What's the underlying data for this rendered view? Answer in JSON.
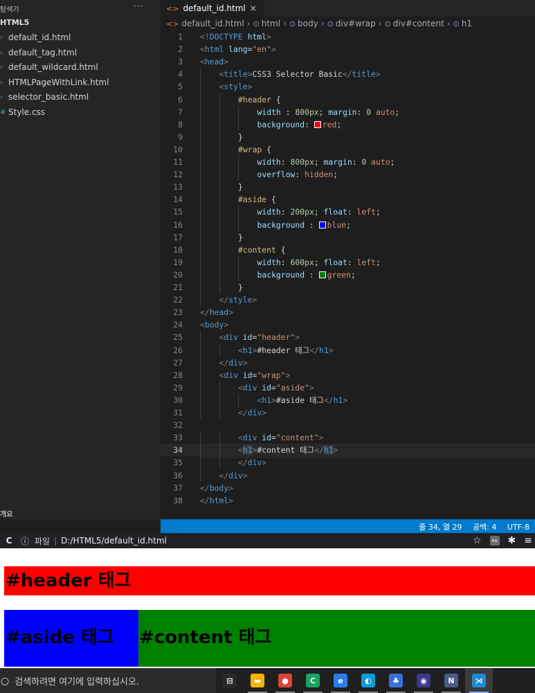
{
  "sidebar": {
    "header": "탐색기",
    "more": "···",
    "folder": "HTML5",
    "files": [
      {
        "name": "default_id.html",
        "icon": "html-file-icon"
      },
      {
        "name": "default_tag.html",
        "icon": "html-file-icon"
      },
      {
        "name": "default_wildcard.html",
        "icon": "html-file-icon"
      },
      {
        "name": "HTMLPageWithLink.html",
        "icon": "html-file-icon"
      },
      {
        "name": "selector_basic.html",
        "icon": "html-file-icon"
      },
      {
        "name": "Style.css",
        "icon": "css-file-icon"
      }
    ],
    "outline": "개요"
  },
  "tab": {
    "label": "default_id.html",
    "close": "×"
  },
  "breadcrumb": [
    "default_id.html",
    "html",
    "body",
    "div#wrap",
    "div#content",
    "h1"
  ],
  "editor": {
    "active_line": 34,
    "lines": [
      {
        "n": 1,
        "indent": 0,
        "tokens": [
          [
            "br",
            "<!"
          ],
          [
            "tg",
            "DOCTYPE"
          ],
          [
            "tx",
            " "
          ],
          [
            "at",
            "html"
          ],
          [
            "br",
            ">"
          ]
        ]
      },
      {
        "n": 2,
        "indent": 0,
        "tokens": [
          [
            "br",
            "<"
          ],
          [
            "tg",
            "html"
          ],
          [
            "tx",
            " "
          ],
          [
            "at",
            "lang"
          ],
          [
            "tx",
            "="
          ],
          [
            "sv",
            "\"en\""
          ],
          [
            "br",
            ">"
          ]
        ]
      },
      {
        "n": 3,
        "indent": 0,
        "tokens": [
          [
            "br",
            "<"
          ],
          [
            "tg",
            "head"
          ],
          [
            "br",
            ">"
          ]
        ]
      },
      {
        "n": 4,
        "indent": 1,
        "tokens": [
          [
            "br",
            "<"
          ],
          [
            "tg",
            "title"
          ],
          [
            "br",
            ">"
          ],
          [
            "tx",
            "CSS3 Selector Basic"
          ],
          [
            "br",
            "</"
          ],
          [
            "tg",
            "title"
          ],
          [
            "br",
            ">"
          ]
        ]
      },
      {
        "n": 5,
        "indent": 1,
        "tokens": [
          [
            "br",
            "<"
          ],
          [
            "tg",
            "style"
          ],
          [
            "br",
            ">"
          ]
        ]
      },
      {
        "n": 6,
        "indent": 2,
        "tokens": [
          [
            "sel",
            "#header"
          ],
          [
            "tx",
            " {"
          ]
        ]
      },
      {
        "n": 7,
        "indent": 3,
        "tokens": [
          [
            "pr",
            "width"
          ],
          [
            "tx",
            " : "
          ],
          [
            "nm",
            "800px"
          ],
          [
            "tx",
            "; "
          ],
          [
            "pr",
            "margin"
          ],
          [
            "tx",
            ": "
          ],
          [
            "nm",
            "0"
          ],
          [
            "tx",
            " "
          ],
          [
            "vl",
            "auto"
          ],
          [
            "tx",
            ";"
          ]
        ]
      },
      {
        "n": 8,
        "indent": 3,
        "tokens": [
          [
            "pr",
            "background"
          ],
          [
            "tx",
            ": "
          ],
          [
            "sw",
            "#ff0000"
          ],
          [
            "vl",
            "red"
          ],
          [
            "tx",
            ";"
          ]
        ]
      },
      {
        "n": 9,
        "indent": 2,
        "tokens": [
          [
            "tx",
            "}"
          ]
        ]
      },
      {
        "n": 10,
        "indent": 2,
        "tokens": [
          [
            "sel",
            "#wrap"
          ],
          [
            "tx",
            " {"
          ]
        ]
      },
      {
        "n": 11,
        "indent": 3,
        "tokens": [
          [
            "pr",
            "width"
          ],
          [
            "tx",
            ": "
          ],
          [
            "nm",
            "800px"
          ],
          [
            "tx",
            "; "
          ],
          [
            "pr",
            "margin"
          ],
          [
            "tx",
            ": "
          ],
          [
            "nm",
            "0"
          ],
          [
            "tx",
            " "
          ],
          [
            "vl",
            "auto"
          ],
          [
            "tx",
            ";"
          ]
        ]
      },
      {
        "n": 12,
        "indent": 3,
        "tokens": [
          [
            "pr",
            "overflow"
          ],
          [
            "tx",
            ": "
          ],
          [
            "vl",
            "hidden"
          ],
          [
            "tx",
            ";"
          ]
        ]
      },
      {
        "n": 13,
        "indent": 2,
        "tokens": [
          [
            "tx",
            "}"
          ]
        ]
      },
      {
        "n": 14,
        "indent": 2,
        "tokens": [
          [
            "sel",
            "#aside"
          ],
          [
            "tx",
            " {"
          ]
        ]
      },
      {
        "n": 15,
        "indent": 3,
        "tokens": [
          [
            "pr",
            "width"
          ],
          [
            "tx",
            ": "
          ],
          [
            "nm",
            "200px"
          ],
          [
            "tx",
            "; "
          ],
          [
            "pr",
            "float"
          ],
          [
            "tx",
            ": "
          ],
          [
            "vl",
            "left"
          ],
          [
            "tx",
            ";"
          ]
        ]
      },
      {
        "n": 16,
        "indent": 3,
        "tokens": [
          [
            "pr",
            "background"
          ],
          [
            "tx",
            " : "
          ],
          [
            "sw",
            "#0000ff"
          ],
          [
            "vl",
            "blue"
          ],
          [
            "tx",
            ";"
          ]
        ]
      },
      {
        "n": 17,
        "indent": 2,
        "tokens": [
          [
            "tx",
            "}"
          ]
        ]
      },
      {
        "n": 18,
        "indent": 2,
        "tokens": [
          [
            "sel",
            "#content"
          ],
          [
            "tx",
            " {"
          ]
        ]
      },
      {
        "n": 19,
        "indent": 3,
        "tokens": [
          [
            "pr",
            "width"
          ],
          [
            "tx",
            ": "
          ],
          [
            "nm",
            "600px"
          ],
          [
            "tx",
            "; "
          ],
          [
            "pr",
            "float"
          ],
          [
            "tx",
            ": "
          ],
          [
            "vl",
            "left"
          ],
          [
            "tx",
            ";"
          ]
        ]
      },
      {
        "n": 20,
        "indent": 3,
        "tokens": [
          [
            "pr",
            "background"
          ],
          [
            "tx",
            " : "
          ],
          [
            "sw",
            "#008000"
          ],
          [
            "vl",
            "green"
          ],
          [
            "tx",
            ";"
          ]
        ]
      },
      {
        "n": 21,
        "indent": 2,
        "tokens": [
          [
            "tx",
            "}"
          ]
        ]
      },
      {
        "n": 22,
        "indent": 1,
        "tokens": [
          [
            "br",
            "</"
          ],
          [
            "tg",
            "style"
          ],
          [
            "br",
            ">"
          ]
        ]
      },
      {
        "n": 23,
        "indent": 0,
        "tokens": [
          [
            "br",
            "</"
          ],
          [
            "tg",
            "head"
          ],
          [
            "br",
            ">"
          ]
        ]
      },
      {
        "n": 24,
        "indent": 0,
        "tokens": [
          [
            "br",
            "<"
          ],
          [
            "tg",
            "body"
          ],
          [
            "br",
            ">"
          ]
        ]
      },
      {
        "n": 25,
        "indent": 1,
        "tokens": [
          [
            "br",
            "<"
          ],
          [
            "tg",
            "div"
          ],
          [
            "tx",
            " "
          ],
          [
            "at",
            "id"
          ],
          [
            "tx",
            "="
          ],
          [
            "sv",
            "\"header\""
          ],
          [
            "br",
            ">"
          ]
        ]
      },
      {
        "n": 26,
        "indent": 2,
        "tokens": [
          [
            "br",
            "<"
          ],
          [
            "tg",
            "h1"
          ],
          [
            "br",
            ">"
          ],
          [
            "tx",
            "#header 태그"
          ],
          [
            "br",
            "</"
          ],
          [
            "tg",
            "h1"
          ],
          [
            "br",
            ">"
          ]
        ]
      },
      {
        "n": 27,
        "indent": 1,
        "tokens": [
          [
            "br",
            "</"
          ],
          [
            "tg",
            "div"
          ],
          [
            "br",
            ">"
          ]
        ]
      },
      {
        "n": 28,
        "indent": 1,
        "tokens": [
          [
            "br",
            "<"
          ],
          [
            "tg",
            "div"
          ],
          [
            "tx",
            " "
          ],
          [
            "at",
            "id"
          ],
          [
            "tx",
            "="
          ],
          [
            "sv",
            "\"wrap\""
          ],
          [
            "br",
            ">"
          ]
        ]
      },
      {
        "n": 29,
        "indent": 2,
        "tokens": [
          [
            "br",
            "<"
          ],
          [
            "tg",
            "div"
          ],
          [
            "tx",
            " "
          ],
          [
            "at",
            "id"
          ],
          [
            "tx",
            "="
          ],
          [
            "sv",
            "\"aside\""
          ],
          [
            "br",
            ">"
          ]
        ]
      },
      {
        "n": 30,
        "indent": 3,
        "tokens": [
          [
            "br",
            "<"
          ],
          [
            "tg",
            "h1"
          ],
          [
            "br",
            ">"
          ],
          [
            "tx",
            "#aside 태그"
          ],
          [
            "br",
            "</"
          ],
          [
            "tg",
            "h1"
          ],
          [
            "br",
            ">"
          ]
        ]
      },
      {
        "n": 31,
        "indent": 2,
        "tokens": [
          [
            "br",
            "</"
          ],
          [
            "tg",
            "div"
          ],
          [
            "br",
            ">"
          ]
        ]
      },
      {
        "n": 32,
        "indent": 0,
        "tokens": []
      },
      {
        "n": 33,
        "indent": 2,
        "tokens": [
          [
            "br",
            "<"
          ],
          [
            "tg",
            "div"
          ],
          [
            "tx",
            " "
          ],
          [
            "at",
            "id"
          ],
          [
            "tx",
            "="
          ],
          [
            "sv",
            "\"content\""
          ],
          [
            "br",
            ">"
          ]
        ]
      },
      {
        "n": 34,
        "indent": 2,
        "tokens": [
          [
            "br",
            "<"
          ],
          [
            "tgh",
            "h1"
          ],
          [
            "br",
            ">"
          ],
          [
            "tx",
            "#content 태그"
          ],
          [
            "br",
            "</"
          ],
          [
            "tgh",
            "h1"
          ],
          [
            "br",
            ">"
          ]
        ]
      },
      {
        "n": 35,
        "indent": 2,
        "tokens": [
          [
            "br",
            "</"
          ],
          [
            "tg",
            "div"
          ],
          [
            "br",
            ">"
          ]
        ]
      },
      {
        "n": 36,
        "indent": 1,
        "tokens": [
          [
            "br",
            "</"
          ],
          [
            "tg",
            "div"
          ],
          [
            "br",
            ">"
          ]
        ]
      },
      {
        "n": 37,
        "indent": 0,
        "tokens": [
          [
            "br",
            "</"
          ],
          [
            "tg",
            "body"
          ],
          [
            "br",
            ">"
          ]
        ]
      },
      {
        "n": 38,
        "indent": 0,
        "tokens": [
          [
            "br",
            "</"
          ],
          [
            "tg",
            "html"
          ],
          [
            "br",
            ">"
          ]
        ]
      }
    ]
  },
  "statusbar": {
    "position": "줄 34, 열 29",
    "spaces": "공백: 4",
    "encoding": "UTF-8"
  },
  "browser": {
    "reload": "C",
    "info": "ⓘ",
    "file_label": "파일",
    "pipe": "|",
    "url": "D:/HTML5/default_id.html",
    "page": {
      "header": "#header 태그",
      "aside": "#aside 태그",
      "content": "#content 태그",
      "colors": {
        "header": "#ff0000",
        "aside": "#0000ff",
        "content": "#008000"
      }
    }
  },
  "taskbar": {
    "search_placeholder": "검색하려면 여기에 입력하십시오.",
    "apps": [
      {
        "name": "task-view-icon",
        "color": "#2b2b2b",
        "glyph": "⊟"
      },
      {
        "name": "file-explorer-icon",
        "color": "#f4b400",
        "glyph": "▬"
      },
      {
        "name": "chrome-icon",
        "color": "#db4437",
        "glyph": "●"
      },
      {
        "name": "app-green-c-icon",
        "color": "#1aa260",
        "glyph": "C"
      },
      {
        "name": "app-blue-e-icon",
        "color": "#2b7de9",
        "glyph": "e"
      },
      {
        "name": "edge-icon",
        "color": "#0f9bd7",
        "glyph": "◐"
      },
      {
        "name": "network-app-icon",
        "color": "#3a6fd8",
        "glyph": "♣"
      },
      {
        "name": "eclipse-icon",
        "color": "#3d3a8a",
        "glyph": "◉"
      },
      {
        "name": "studio-icon",
        "color": "#4a5a8a",
        "glyph": "N"
      },
      {
        "name": "vscode-icon",
        "color": "#1f8ad2",
        "glyph": "⋊"
      }
    ]
  }
}
